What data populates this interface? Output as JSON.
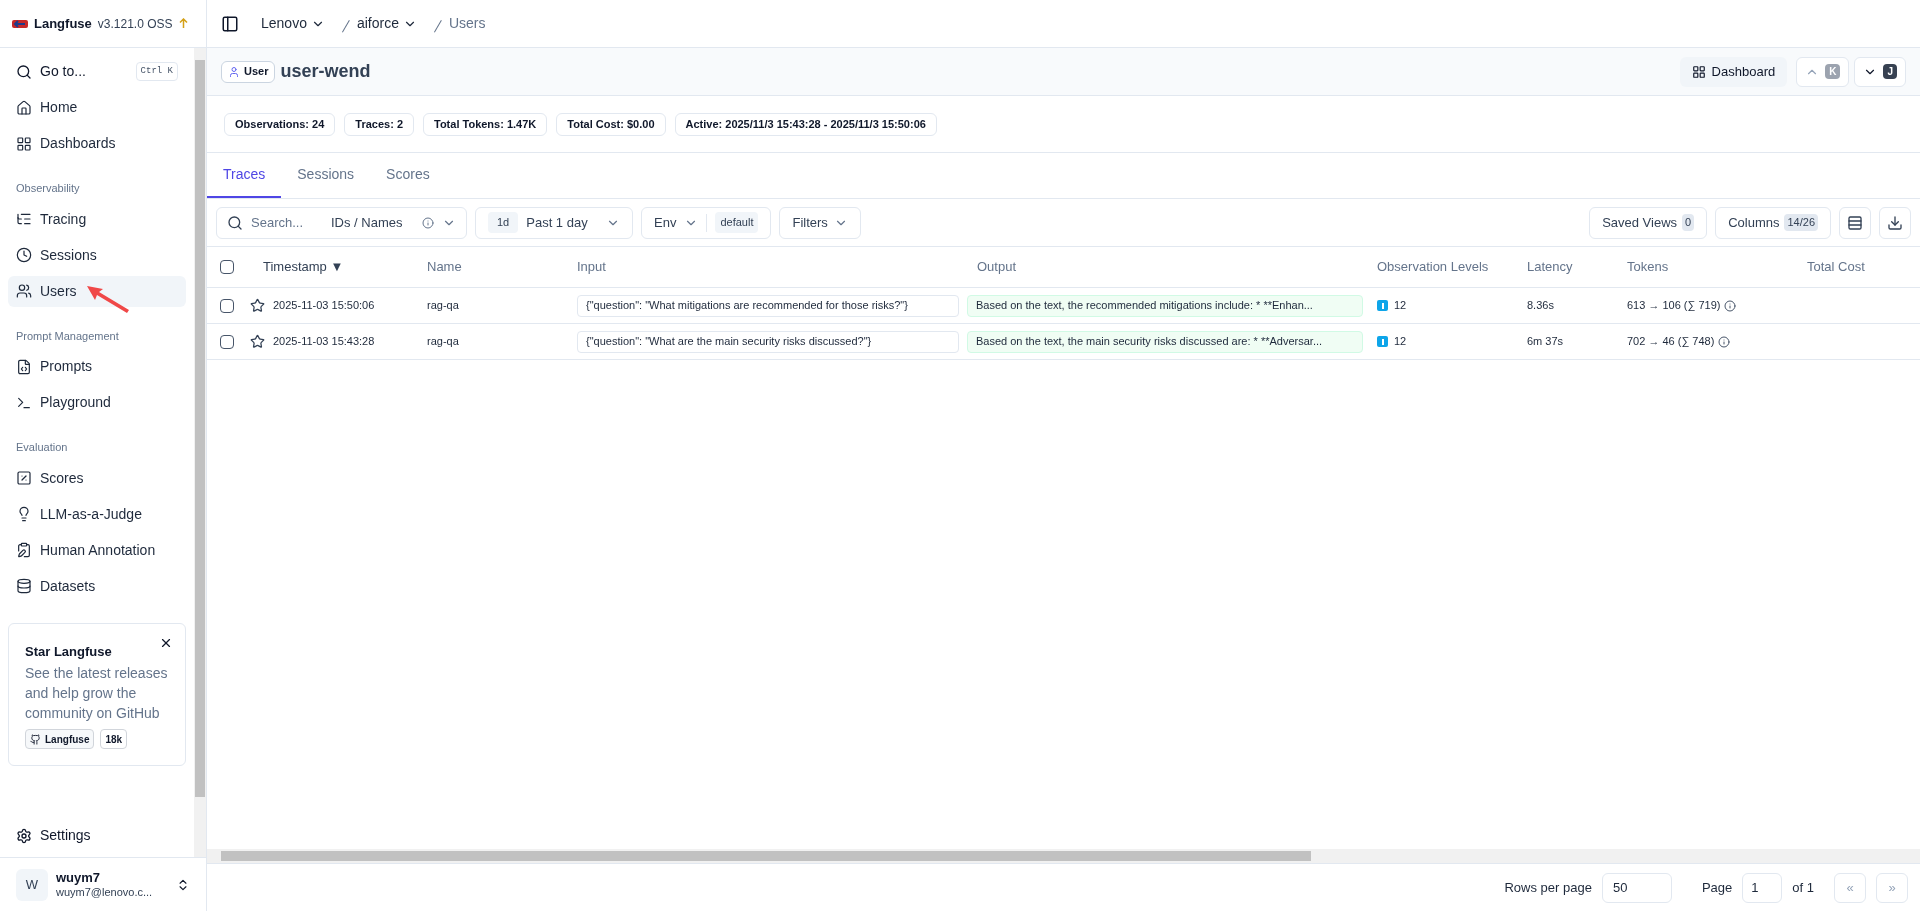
{
  "brand": {
    "name": "Langfuse",
    "version": "v3.121.0 OSS"
  },
  "sidebar": {
    "goto": {
      "label": "Go to...",
      "shortcut": "Ctrl K"
    },
    "top_items": [
      {
        "label": "Home",
        "selected": false
      },
      {
        "label": "Dashboards",
        "selected": false
      }
    ],
    "sections": [
      {
        "heading": "Observability",
        "items": [
          {
            "label": "Tracing",
            "selected": false
          },
          {
            "label": "Sessions",
            "selected": false
          },
          {
            "label": "Users",
            "selected": true
          }
        ]
      },
      {
        "heading": "Prompt Management",
        "items": [
          {
            "label": "Prompts",
            "selected": false
          },
          {
            "label": "Playground",
            "selected": false
          }
        ]
      },
      {
        "heading": "Evaluation",
        "items": [
          {
            "label": "Scores",
            "selected": false
          },
          {
            "label": "LLM-as-a-Judge",
            "selected": false
          },
          {
            "label": "Human Annotation",
            "selected": false
          },
          {
            "label": "Datasets",
            "selected": false
          }
        ]
      }
    ],
    "promo": {
      "title": "Star Langfuse",
      "text": "See the latest releases and help grow the community on GitHub",
      "repo": "Langfuse",
      "stars": "18k"
    },
    "settings": "Settings",
    "account": {
      "initial": "W",
      "name": "wuym7",
      "email": "wuym7@lenovo.c..."
    }
  },
  "breadcrumb": [
    {
      "label": "Lenovo",
      "dropdown": true
    },
    {
      "label": "aiforce",
      "dropdown": true
    },
    {
      "label": "Users",
      "dropdown": false
    }
  ],
  "entity": {
    "badge": "User",
    "title": "user-wend",
    "dashboard": "Dashboard",
    "prev_key": "K",
    "next_key": "J"
  },
  "stats": [
    {
      "label": "Observations:",
      "value": "24"
    },
    {
      "label": "Traces:",
      "value": "2"
    },
    {
      "label": "Total Tokens:",
      "value": "1.47K"
    },
    {
      "label": "Total Cost:",
      "value": "$0.00"
    },
    {
      "label": "Active:",
      "value": "2025/11/3 15:43:28 - 2025/11/3 15:50:06"
    }
  ],
  "tabs": [
    {
      "label": "Traces",
      "selected": true
    },
    {
      "label": "Sessions",
      "selected": false
    },
    {
      "label": "Scores",
      "selected": false
    }
  ],
  "toolbar": {
    "search_placeholder": "Search...",
    "search_mode": "IDs / Names",
    "range_short": "1d",
    "range": "Past 1 day",
    "env_label": "Env",
    "env_value": "default",
    "filters": "Filters",
    "saved_views": "Saved Views",
    "saved_views_count": "0",
    "columns": "Columns",
    "columns_count": "14/26"
  },
  "table": {
    "header_checked": false,
    "columns": [
      "Timestamp ▼",
      "Name",
      "Input",
      "Output",
      "Observation Levels",
      "Latency",
      "Tokens",
      "Total Cost"
    ],
    "rows": [
      {
        "checked": false,
        "starred": false,
        "timestamp": "2025-11-03 15:50:06",
        "name": "rag-qa",
        "input": "{\"question\": \"What mitigations are recommended for those risks?\"}",
        "output": "Based on the text, the recommended mitigations include: * **Enhan...",
        "observation_levels": "12",
        "latency": "8.36s",
        "tokens": "613 → 106 (∑ 719)"
      },
      {
        "checked": false,
        "starred": false,
        "timestamp": "2025-11-03 15:43:28",
        "name": "rag-qa",
        "input": "{\"question\": \"What are the main security risks discussed?\"}",
        "output": "Based on the text, the main security risks discussed are: * **Adversar...",
        "observation_levels": "12",
        "latency": "6m 37s",
        "tokens": "702 → 46 (∑ 748)"
      }
    ]
  },
  "pagination": {
    "rows_label": "Rows per page",
    "rows_value": "50",
    "page_label": "Page",
    "page_value": "1",
    "page_total": "of 1",
    "first": "«",
    "last": "»"
  }
}
